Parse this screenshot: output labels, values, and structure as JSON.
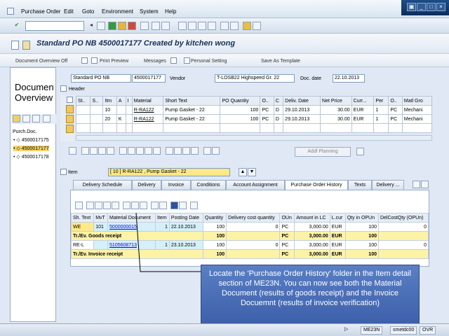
{
  "menu": {
    "items": [
      "Purchase Order",
      "Edit",
      "Goto",
      "Environment",
      "System",
      "Help"
    ]
  },
  "title": "Standard PO NB 4500017177 Created by kitchen wong",
  "app_toolbar": {
    "doc_overview": "Document Overview Off",
    "print_preview": "Print Preview",
    "messages": "Messages",
    "personal_setting": "Personal Setting",
    "save_template": "Save As Template"
  },
  "left_panel": {
    "title": "Document Overview",
    "header": "Purch.Doc.",
    "items": [
      "4500017175",
      "4500017177",
      "4500017178"
    ]
  },
  "header_fields": {
    "doc_type": "Standard PO NB",
    "po_number": "4500017177",
    "vendor_label": "Vendor",
    "vendor": "T-LOSB22 Highspeed Gr. 22",
    "doc_date_label": "Doc. date",
    "doc_date": "22.10.2013",
    "header_label": "Header"
  },
  "item_table": {
    "columns": [
      "St..",
      "S..",
      "Itm",
      "A",
      "I",
      "Material",
      "Short Text",
      "PO Quantity",
      "O..",
      "C",
      "Deliv. Date",
      "Net Price",
      "Curr...",
      "Per",
      "O..",
      "Matl Gro"
    ],
    "rows": [
      {
        "itm": "10",
        "a": "",
        "material": "R-RA122",
        "short_text": "Pump Gasket - 22",
        "qty": "100",
        "o": "PC",
        "c": "D",
        "date": "29.10.2013",
        "price": "30.00",
        "curr": "EUR",
        "per": "1",
        "unit": "PC",
        "matl": "Mechani"
      },
      {
        "itm": "20",
        "a": "K",
        "material": "R-RA122",
        "short_text": "Pump Gasket - 22",
        "qty": "100",
        "o": "PC",
        "c": "D",
        "date": "29.10.2013",
        "price": "30.00",
        "curr": "EUR",
        "per": "1",
        "unit": "PC",
        "matl": "Mechani"
      }
    ]
  },
  "add_planning": "Addl Planning",
  "item_selector": {
    "label": "Item",
    "value": "[ 10 ] R-RA122 , Pump Gasket - 22"
  },
  "tabs": [
    "Delivery Schedule",
    "Delivery",
    "Invoice",
    "Conditions",
    "Account Assignment",
    "Purchase Order History",
    "Texts",
    "Delivery ..."
  ],
  "history": {
    "columns": [
      "Sh. Text",
      "MvT",
      "Material Document",
      "Item",
      "Posting Date",
      "Quantity",
      "Delivery cost quantity",
      "OUn",
      "Amount in LC",
      "L.cur",
      "Qty in OPUn",
      "DelCostQty (OPUn)"
    ],
    "rows": [
      {
        "type": "data",
        "sh": "WE",
        "mvt": "101",
        "doc": "5000000015",
        "item": "1",
        "date": "22.10.2013",
        "qty": "100",
        "dcq": "0",
        "oun": "PC",
        "amt": "3,000.00",
        "cur": "EUR",
        "qop": "100",
        "dcop": "0"
      },
      {
        "type": "sub",
        "sh": "Tr./Ev. Goods receipt",
        "qty": "100",
        "oun": "PC",
        "amt": "3,000.00",
        "cur": "EUR",
        "qop": "100"
      },
      {
        "type": "data",
        "sh": "RE-L",
        "mvt": "",
        "doc": "5105608713",
        "item": "1",
        "date": "23.10.2013",
        "qty": "100",
        "dcq": "0",
        "oun": "PC",
        "amt": "3,000.00",
        "cur": "EUR",
        "qop": "100",
        "dcop": "0"
      },
      {
        "type": "sub",
        "sh": "Tr./Ev. Invoice receipt",
        "qty": "100",
        "oun": "PC",
        "amt": "3,000.00",
        "cur": "EUR",
        "qop": "100"
      }
    ]
  },
  "callout": "Locate the 'Purchase Order History' folder in the Item detail section of ME23N. You can now see both the Material Document (results of goods receipt) and the Invoice Docuemnt (results of invoice verification)",
  "status": {
    "tcode": "ME23N",
    "server": "smetdc00",
    "mode": "OVR"
  }
}
